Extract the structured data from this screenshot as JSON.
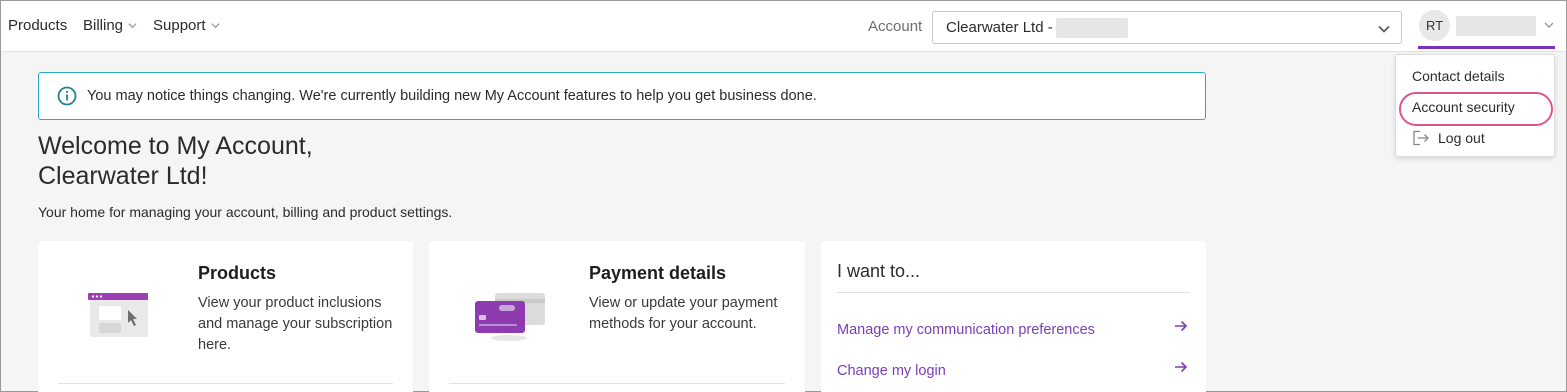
{
  "nav": {
    "products_label": "Products",
    "billing_label": "Billing",
    "support_label": "Support"
  },
  "account": {
    "label": "Account",
    "selected_value": "Clearwater Ltd -"
  },
  "user": {
    "initials": "RT"
  },
  "user_dropdown": {
    "items": [
      {
        "label": "Contact details"
      },
      {
        "label": "Account security"
      },
      {
        "label": "Log out"
      }
    ]
  },
  "banner": {
    "text": "You may notice things changing. We're currently building new My Account features to help you get business done."
  },
  "welcome": {
    "title_line1": "Welcome to My Account,",
    "title_line2": "Clearwater Ltd!",
    "subtitle": "Your home for managing your account, billing and product settings."
  },
  "cards": {
    "products": {
      "title": "Products",
      "description": "View your product inclusions and manage your subscription here."
    },
    "payment": {
      "title": "Payment details",
      "description": "View or update your payment methods for your account."
    },
    "iwant": {
      "title": "I want to...",
      "links": [
        {
          "label": "Manage my communication preferences"
        },
        {
          "label": "Change my login"
        }
      ]
    }
  },
  "colors": {
    "accent_purple": "#7b2fbe",
    "link_purple": "#7b3fb5",
    "info_blue": "#2aa9c6",
    "highlight_pink": "#e0548e"
  },
  "icons": {
    "info": "info-circle-icon",
    "chevron": "chevron-down-icon",
    "logout": "logout-icon",
    "arrow": "arrow-right-icon"
  }
}
